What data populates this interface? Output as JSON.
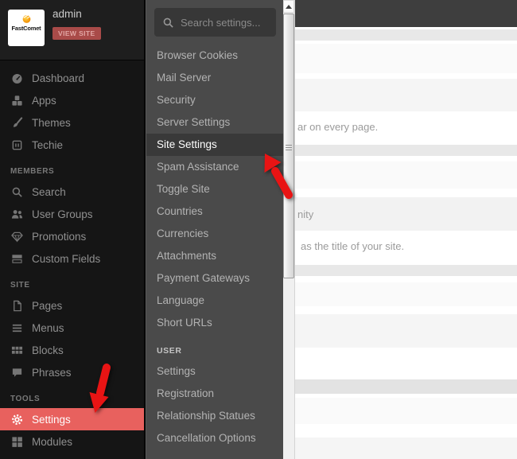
{
  "account": {
    "logo_text": "FastComet",
    "logo_icon": "comet-icon",
    "username": "admin",
    "view_site_label": "VIEW SITE"
  },
  "sidebar": {
    "main_items": [
      {
        "label": "Dashboard",
        "icon": "dashboard-icon"
      },
      {
        "label": "Apps",
        "icon": "apps-icon"
      },
      {
        "label": "Themes",
        "icon": "themes-icon"
      },
      {
        "label": "Techie",
        "icon": "techie-icon"
      }
    ],
    "sections": [
      {
        "title": "MEMBERS",
        "items": [
          {
            "label": "Search",
            "icon": "search-icon"
          },
          {
            "label": "User Groups",
            "icon": "user-groups-icon"
          },
          {
            "label": "Promotions",
            "icon": "promotions-icon"
          },
          {
            "label": "Custom Fields",
            "icon": "custom-fields-icon"
          }
        ]
      },
      {
        "title": "SITE",
        "items": [
          {
            "label": "Pages",
            "icon": "pages-icon"
          },
          {
            "label": "Menus",
            "icon": "menus-icon"
          },
          {
            "label": "Blocks",
            "icon": "blocks-icon"
          },
          {
            "label": "Phrases",
            "icon": "phrases-icon"
          }
        ]
      },
      {
        "title": "TOOLS",
        "items": [
          {
            "label": "Settings",
            "icon": "settings-gear-icon",
            "active": true
          },
          {
            "label": "Modules",
            "icon": "modules-icon"
          }
        ]
      }
    ]
  },
  "settings_menu": {
    "search_placeholder": "Search settings...",
    "items": [
      "Browser Cookies",
      "Mail Server",
      "Security",
      "Server Settings",
      "Site Settings",
      "Spam Assistance",
      "Toggle Site",
      "Countries",
      "Currencies",
      "Attachments",
      "Payment Gateways",
      "Language",
      "Short URLs"
    ],
    "active_item": "Site Settings",
    "user_section_title": "USER",
    "user_items": [
      "Settings",
      "Registration",
      "Relationship Statues",
      "Cancellation Options"
    ]
  },
  "content": {
    "visible_text_fragments": [
      "ar on every page.",
      "nity",
      "as the title of your site."
    ]
  },
  "colors": {
    "active_red": "#e8615e",
    "arrow_red": "#e81414",
    "sidebar_bg": "#151515",
    "flyout_bg": "#4a4a4a",
    "content_header_bar": "#3e3e3e"
  }
}
